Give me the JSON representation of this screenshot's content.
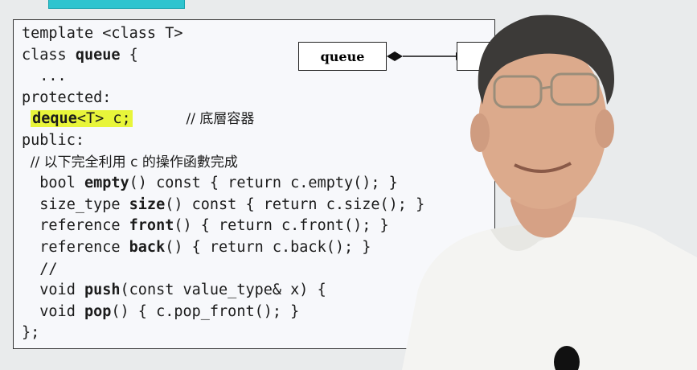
{
  "slide": {
    "code_lines": [
      "template <class T>",
      "class queue {",
      "  ...",
      "protected:",
      "deque<T> c;",
      "// 底層容器",
      "public:",
      "  // 以下完全利用 c 的操作函數完成",
      "  bool empty() const { return c.empty(); }",
      "  size_type size() const { return c.size(); }",
      "  reference front() { return c.front(); }",
      "  reference back() { return c.back(); }",
      "  //",
      "  void push(const value_type& x) {",
      "  void pop() { c.pop_front(); }",
      "};"
    ],
    "keywords": [
      "queue",
      "deque",
      "empty",
      "size",
      "front",
      "back",
      "push",
      "pop"
    ],
    "diagram": {
      "left_box_label": "queue",
      "right_box_label": ""
    }
  },
  "colors": {
    "highlight": "#e8f53a",
    "tab_accent": "#2fc4cf",
    "slide_bg": "#f7f8fb"
  }
}
